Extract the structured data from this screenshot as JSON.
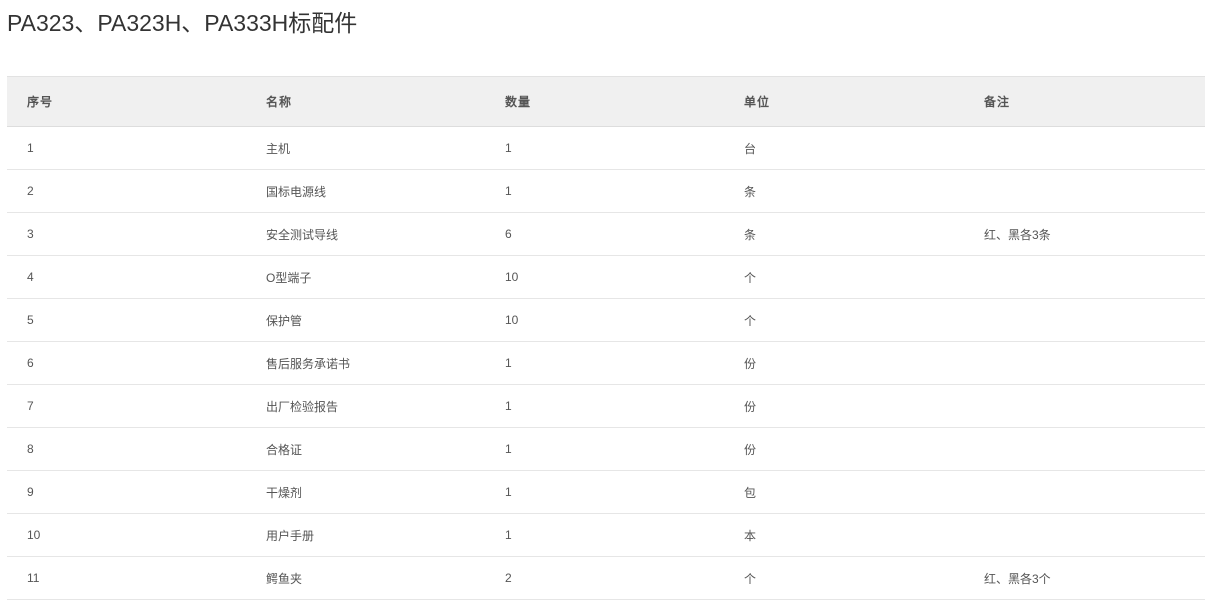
{
  "page": {
    "title": "PA323、PA323H、PA333H标配件"
  },
  "table": {
    "headers": [
      "序号",
      "名称",
      "数量",
      "单位",
      "备注"
    ],
    "rows": [
      [
        "1",
        "主机",
        "1",
        "台",
        ""
      ],
      [
        "2",
        "国标电源线",
        "1",
        "条",
        ""
      ],
      [
        "3",
        "安全测试导线",
        "6",
        "条",
        "红、黑各3条"
      ],
      [
        "4",
        "O型端子",
        "10",
        "个",
        ""
      ],
      [
        "5",
        "保护管",
        "10",
        "个",
        ""
      ],
      [
        "6",
        "售后服务承诺书",
        "1",
        "份",
        ""
      ],
      [
        "7",
        "出厂检验报告",
        "1",
        "份",
        ""
      ],
      [
        "8",
        "合格证",
        "1",
        "份",
        ""
      ],
      [
        "9",
        "干燥剂",
        "1",
        "包",
        ""
      ],
      [
        "10",
        "用户手册",
        "1",
        "本",
        ""
      ],
      [
        "11",
        "鳄鱼夹",
        "2",
        "个",
        "红、黑各3个"
      ]
    ]
  },
  "colors": {
    "header_bg": "#f0f0f0",
    "row_border": "#e6e6e6",
    "text": "#555555",
    "title_text": "#333333"
  }
}
